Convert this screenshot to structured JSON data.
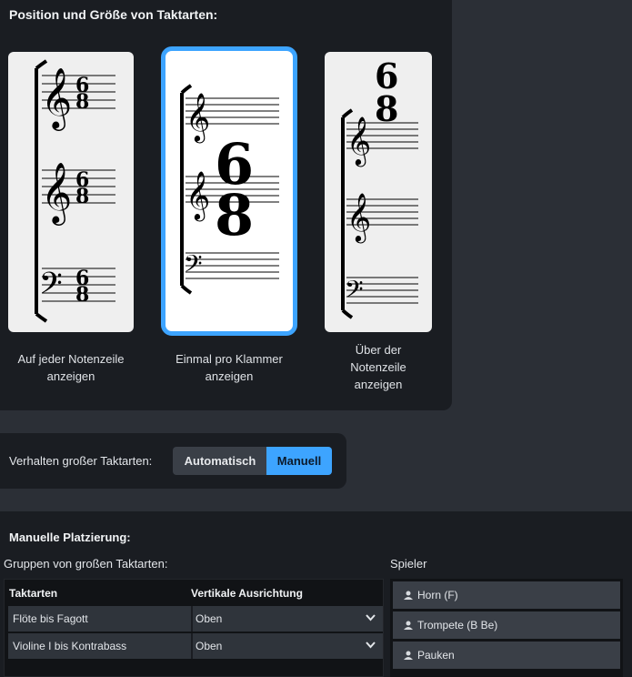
{
  "position_section": {
    "title": "Position und Größe von Taktarten:",
    "options": [
      {
        "label": "Auf jeder Notenzeile anzeigen",
        "selected": false
      },
      {
        "label": "Einmal pro Klammer anzeigen",
        "selected": true
      },
      {
        "label": "Über der Notenzeile anzeigen",
        "selected": false
      }
    ],
    "time_signature": {
      "numerator": "6",
      "denominator": "8"
    }
  },
  "behavior": {
    "label": "Verhalten großer Taktarten:",
    "options": [
      "Automatisch",
      "Manuell"
    ],
    "selected": "Manuell"
  },
  "manual_placement": {
    "title": "Manuelle Platzierung:",
    "groups_label": "Gruppen von großen Taktarten:",
    "players_label": "Spieler",
    "table": {
      "headers": [
        "Taktarten",
        "Vertikale Ausrichtung"
      ],
      "rows": [
        {
          "group": "Flöte bis Fagott",
          "alignment": "Oben"
        },
        {
          "group": "Violine I bis Kontrabass",
          "alignment": "Oben"
        }
      ]
    },
    "players": [
      {
        "name": "Horn (F)",
        "icon": "person-icon"
      },
      {
        "name": "Trompete (B Be)",
        "icon": "person-icon"
      },
      {
        "name": "Pauken",
        "icon": "person-icon"
      }
    ]
  },
  "colors": {
    "accent": "#3da4ff",
    "panel": "#1a1d22",
    "background": "#2b2f36"
  }
}
